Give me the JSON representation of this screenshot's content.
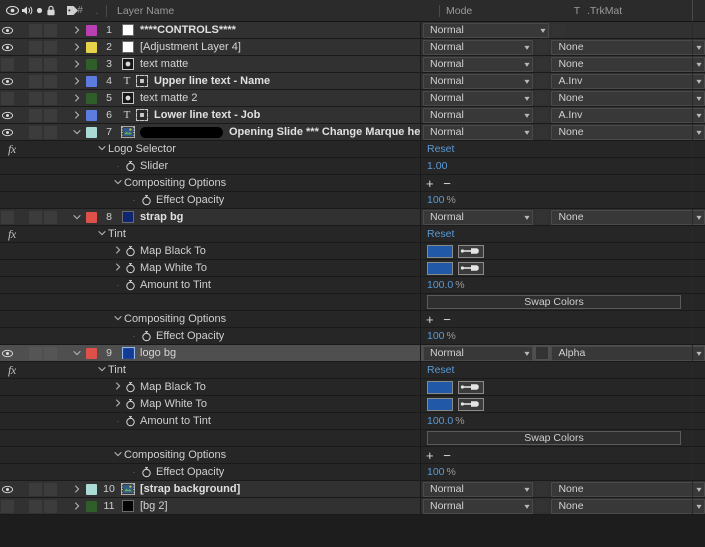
{
  "panel": {
    "title": "After Effects Timeline Panel"
  },
  "header": {
    "icons": [
      "eye-icon",
      "audio-icon",
      "solo-icon",
      "lock-icon",
      "label-tag-icon"
    ],
    "number_col": "#",
    "dot_col": ".",
    "layer_name": "Layer Name",
    "mode": "Mode",
    "t": "T",
    "trkmat": ".TrkMat"
  },
  "rows": [
    {
      "kind": "layer",
      "eye": true,
      "twirl": "closed",
      "label_color": "#b93fb3",
      "num": "1",
      "source_icon": "solid-white",
      "name": "****CONTROLS****",
      "bold": true,
      "mode": "Normal",
      "trkmat": null,
      "selected": false
    },
    {
      "kind": "layer",
      "eye": true,
      "twirl": "closed",
      "label_color": "#e6d34a",
      "num": "2",
      "source_icon": "solid-white",
      "name": "[Adjustment Layer 4]",
      "bold": false,
      "mode": "Normal",
      "trkmat": "None",
      "selected": false
    },
    {
      "kind": "layer",
      "eye": false,
      "twirl": "closed",
      "label_color": "#2f5e2a",
      "num": "3",
      "source_icon": "shape-black",
      "name": "text matte",
      "bold": false,
      "mode": "Normal",
      "trkmat": "None",
      "selected": false
    },
    {
      "kind": "layer",
      "eye": true,
      "twirl": "closed",
      "label_color": "#5c7ce0",
      "num": "4",
      "source_icon": "text-layer",
      "text_marker": "T",
      "name": "Upper line text - Name",
      "bold": true,
      "mode": "Normal",
      "trkmat": "A.Inv",
      "selected": false
    },
    {
      "kind": "layer",
      "eye": false,
      "twirl": "closed",
      "label_color": "#2f5e2a",
      "num": "5",
      "source_icon": "shape-black",
      "name": "text matte 2",
      "bold": false,
      "mode": "Normal",
      "trkmat": "None",
      "selected": false
    },
    {
      "kind": "layer",
      "eye": true,
      "twirl": "closed",
      "label_color": "#5c7ce0",
      "num": "6",
      "source_icon": "text-layer",
      "text_marker": "T",
      "name": "Lower line text - Job",
      "bold": true,
      "mode": "Normal",
      "trkmat": "A.Inv",
      "selected": false
    },
    {
      "kind": "layer",
      "eye": true,
      "twirl": "open",
      "label_color": "#aadcd5",
      "num": "7",
      "source_icon": "comp-icon",
      "redacted": true,
      "name": "Opening Slide *** Change Marque here]",
      "bold": true,
      "mode": "Normal",
      "trkmat": "None",
      "selected": false
    },
    {
      "kind": "prop",
      "fx": true,
      "twirl": "open",
      "indent": 1,
      "name": "Logo Selector",
      "value_kind": "reset",
      "value": "Reset"
    },
    {
      "kind": "prop",
      "dot": true,
      "stopwatch": true,
      "indent": 2,
      "name": "Slider",
      "value_kind": "text",
      "value": "1.00"
    },
    {
      "kind": "prop",
      "twirl": "open",
      "indent": 2,
      "name": "Compositing Options",
      "value_kind": "plusminus",
      "value": "+ −"
    },
    {
      "kind": "prop",
      "dot": true,
      "stopwatch": true,
      "indent": 3,
      "name": "Effect Opacity",
      "value_kind": "percent",
      "value": "100",
      "unit": "%"
    },
    {
      "kind": "layer",
      "eye": false,
      "twirl": "open",
      "label_color": "#e0504a",
      "num": "8",
      "source_icon": "solid-navy",
      "name": "strap bg",
      "bold": true,
      "mode": "Normal",
      "trkmat": "None",
      "selected": false
    },
    {
      "kind": "prop",
      "fx": true,
      "twirl": "open",
      "indent": 1,
      "name": "Tint",
      "value_kind": "reset",
      "value": "Reset"
    },
    {
      "kind": "prop",
      "ptwirl": true,
      "stopwatch": true,
      "indent": 2,
      "name": "Map Black To",
      "value_kind": "color",
      "color": "#2158a8"
    },
    {
      "kind": "prop",
      "ptwirl": true,
      "stopwatch": true,
      "indent": 2,
      "name": "Map White To",
      "value_kind": "color",
      "color": "#2158a8"
    },
    {
      "kind": "prop",
      "dot": true,
      "stopwatch": true,
      "indent": 2,
      "name": "Amount to Tint",
      "value_kind": "percent",
      "value": "100.0",
      "unit": "%"
    },
    {
      "kind": "prop",
      "indent": 2,
      "name": "",
      "value_kind": "swap",
      "value": "Swap Colors"
    },
    {
      "kind": "prop",
      "twirl": "open",
      "indent": 2,
      "name": "Compositing Options",
      "value_kind": "plusminus",
      "value": "+ −"
    },
    {
      "kind": "prop",
      "dot": true,
      "stopwatch": true,
      "indent": 3,
      "name": "Effect Opacity",
      "value_kind": "percent",
      "value": "100",
      "unit": "%"
    },
    {
      "kind": "layer",
      "eye": true,
      "twirl": "open",
      "label_color": "#e0504a",
      "num": "9",
      "source_icon": "solid-navy-sel",
      "name": "logo bg",
      "bold": false,
      "mode": "Normal",
      "trkmat": "Alpha",
      "selected": true
    },
    {
      "kind": "prop",
      "fx": true,
      "twirl": "open",
      "indent": 1,
      "name": "Tint",
      "value_kind": "reset",
      "value": "Reset"
    },
    {
      "kind": "prop",
      "ptwirl": true,
      "stopwatch": true,
      "indent": 2,
      "name": "Map Black To",
      "value_kind": "color",
      "color": "#2158a8"
    },
    {
      "kind": "prop",
      "ptwirl": true,
      "stopwatch": true,
      "indent": 2,
      "name": "Map White To",
      "value_kind": "color",
      "color": "#2158a8"
    },
    {
      "kind": "prop",
      "dot": true,
      "stopwatch": true,
      "indent": 2,
      "name": "Amount to Tint",
      "value_kind": "percent",
      "value": "100.0",
      "unit": "%"
    },
    {
      "kind": "prop",
      "indent": 2,
      "name": "",
      "value_kind": "swap",
      "value": "Swap Colors"
    },
    {
      "kind": "prop",
      "twirl": "open",
      "indent": 2,
      "name": "Compositing Options",
      "value_kind": "plusminus",
      "value": "+ −"
    },
    {
      "kind": "prop",
      "dot": true,
      "stopwatch": true,
      "indent": 3,
      "name": "Effect Opacity",
      "value_kind": "percent",
      "value": "100",
      "unit": "%"
    },
    {
      "kind": "layer",
      "eye": true,
      "twirl": "closed",
      "label_color": "#aadcd5",
      "num": "10",
      "source_icon": "comp-icon",
      "name": "[strap background]",
      "bold": true,
      "mode": "Normal",
      "trkmat": "None",
      "selected": false
    },
    {
      "kind": "layer",
      "eye": false,
      "twirl": "closed",
      "label_color": "#2f5e2a",
      "num": "11",
      "source_icon": "solid-black",
      "name": "[bg 2]",
      "bold": false,
      "mode": "Normal",
      "trkmat": "None",
      "selected": false
    }
  ],
  "colors": {
    "panel_bg": "#1d1d1d",
    "header_bg": "#2b2b2b",
    "layer_row_bg": "#313131",
    "prop_row_bg": "#262626",
    "selected_row_bg": "#4f4f4f",
    "link_blue": "#5b9ad6",
    "tint_swatch": "#2158a8"
  }
}
